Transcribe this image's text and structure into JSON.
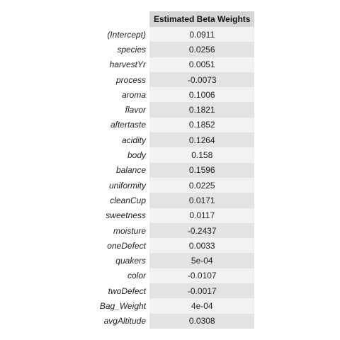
{
  "table": {
    "header": "Estimated Beta Weights",
    "rows": [
      {
        "term": "(Intercept)",
        "value": "0.0911"
      },
      {
        "term": "species",
        "value": "0.0256"
      },
      {
        "term": "harvestYr",
        "value": "0.0051"
      },
      {
        "term": "process",
        "value": "-0.0073"
      },
      {
        "term": "aroma",
        "value": "0.1006"
      },
      {
        "term": "flavor",
        "value": "0.1821"
      },
      {
        "term": "aftertaste",
        "value": "0.1852"
      },
      {
        "term": "acidity",
        "value": "0.1264"
      },
      {
        "term": "body",
        "value": "0.158"
      },
      {
        "term": "balance",
        "value": "0.1596"
      },
      {
        "term": "uniformity",
        "value": "0.0225"
      },
      {
        "term": "cleanCup",
        "value": "0.0171"
      },
      {
        "term": "sweetness",
        "value": "0.0117"
      },
      {
        "term": "moisture",
        "value": "-0.2437"
      },
      {
        "term": "oneDefect",
        "value": "0.0033"
      },
      {
        "term": "quakers",
        "value": "5e-04"
      },
      {
        "term": "color",
        "value": "-0.0107"
      },
      {
        "term": "twoDefect",
        "value": "-0.0017"
      },
      {
        "term": "Bag_Weight",
        "value": "4e-04"
      },
      {
        "term": "avgAltitude",
        "value": "0.0308"
      }
    ]
  }
}
